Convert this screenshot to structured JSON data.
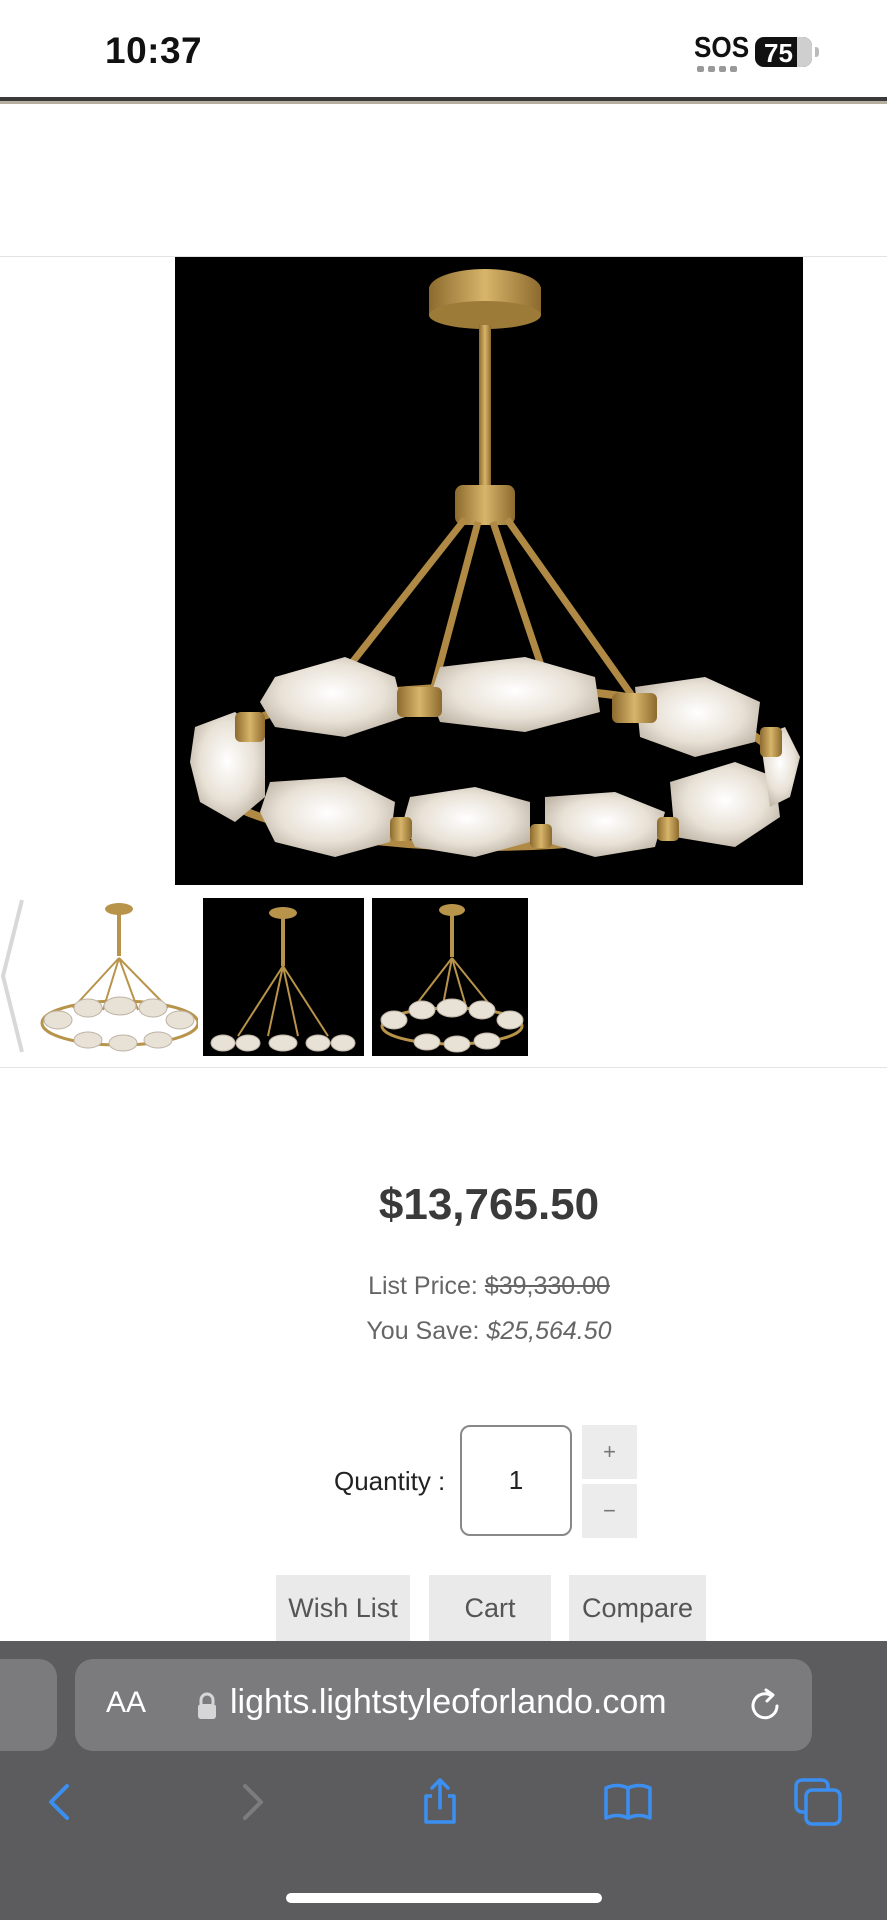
{
  "status_bar": {
    "time": "10:37",
    "sos": "SOS",
    "battery": "75"
  },
  "product": {
    "price": "$13,765.50",
    "list_price_label": "List Price:",
    "list_price_value": "$39,330.00",
    "you_save_label": "You Save:",
    "you_save_value": "$25,564.50",
    "quantity_label": "Quantity :",
    "quantity_value": "1",
    "plus_label": "+",
    "minus_label": "−",
    "actions": {
      "wish_list": "Wish List",
      "cart": "Cart",
      "compare": "Compare"
    }
  },
  "browser": {
    "aa_label": "AA",
    "url": "lights.lightstyleoforlando.com",
    "toolbar_icons": [
      "back-icon",
      "forward-icon",
      "share-icon",
      "bookmarks-icon",
      "tabs-icon"
    ]
  },
  "colors": {
    "brass": "#b8934a",
    "browser_chrome": "#5c5c5e",
    "ios_blue": "#3b8ff0"
  }
}
